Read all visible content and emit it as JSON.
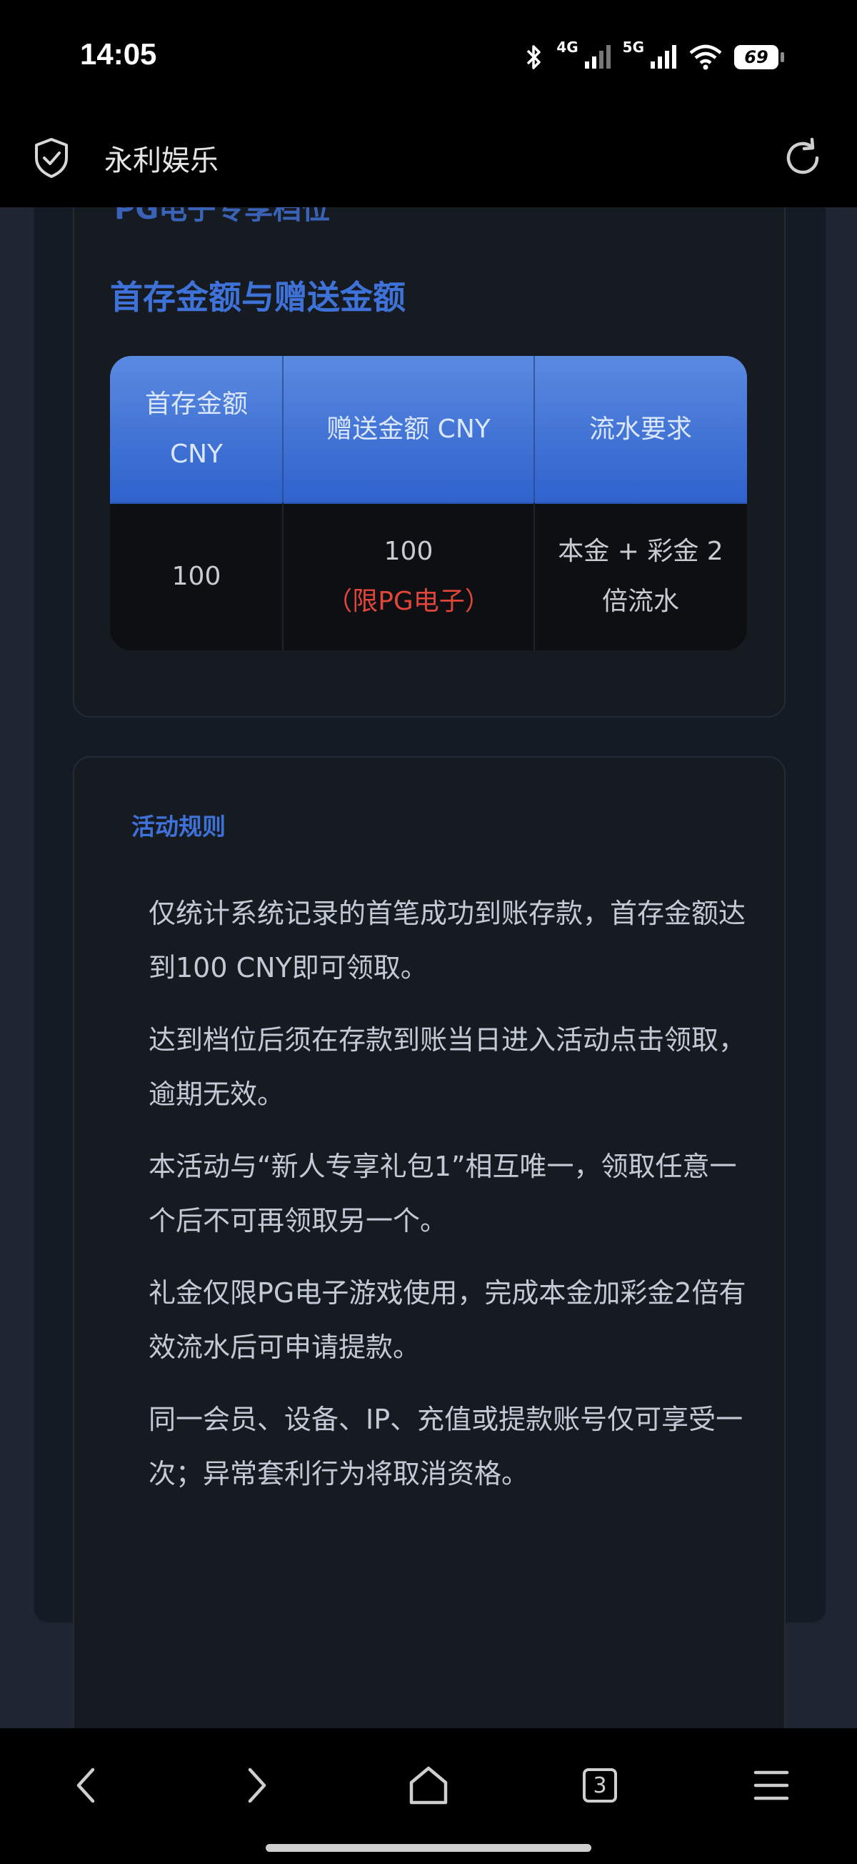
{
  "status_bar": {
    "time": "14:05",
    "network_1": "4G",
    "network_2": "5G",
    "battery": "69",
    "icons": [
      "bluetooth-icon",
      "signal-icon",
      "signal-icon",
      "wifi-icon",
      "battery-icon"
    ]
  },
  "browser": {
    "title": "永利娱乐",
    "icons": [
      "shield-check-icon",
      "reload-icon"
    ]
  },
  "page": {
    "cut_heading": "PG电子专享档位",
    "section_title": "首存金额与赠送金额",
    "table": {
      "headers": [
        "首存金额 CNY",
        "赠送金额 CNY",
        "流水要求"
      ],
      "row": {
        "deposit": "100",
        "bonus": "100",
        "bonus_note": "（限PG电子）",
        "turnover": "本金 + 彩金 2 倍流水"
      }
    },
    "rules_label": "活动规则",
    "rules": [
      "仅统计系统记录的首笔成功到账存款，首存金额达到100 CNY即可领取。",
      "达到档位后须在存款到账当日进入活动点击领取，逾期无效。",
      "本活动与“新人专享礼包1”相互唯一，领取任意一个后不可再领取另一个。",
      "礼金仅限PG电子游戏使用，完成本金加彩金2倍有效流水后可申请提款。",
      "同一会员、设备、IP、充值或提款账号仅可享受一次；异常套利行为将取消资格。"
    ]
  },
  "bottom_nav": {
    "tab_count": "3",
    "icons": [
      "back-icon",
      "forward-icon",
      "home-icon",
      "tabs-icon",
      "menu-icon"
    ]
  },
  "colors": {
    "accent": "#3f72d8",
    "header_gradient_top": "#5a8ae0",
    "header_gradient_bottom": "#2f62cc",
    "note_red": "#e0463a",
    "background": "#1f2632"
  }
}
